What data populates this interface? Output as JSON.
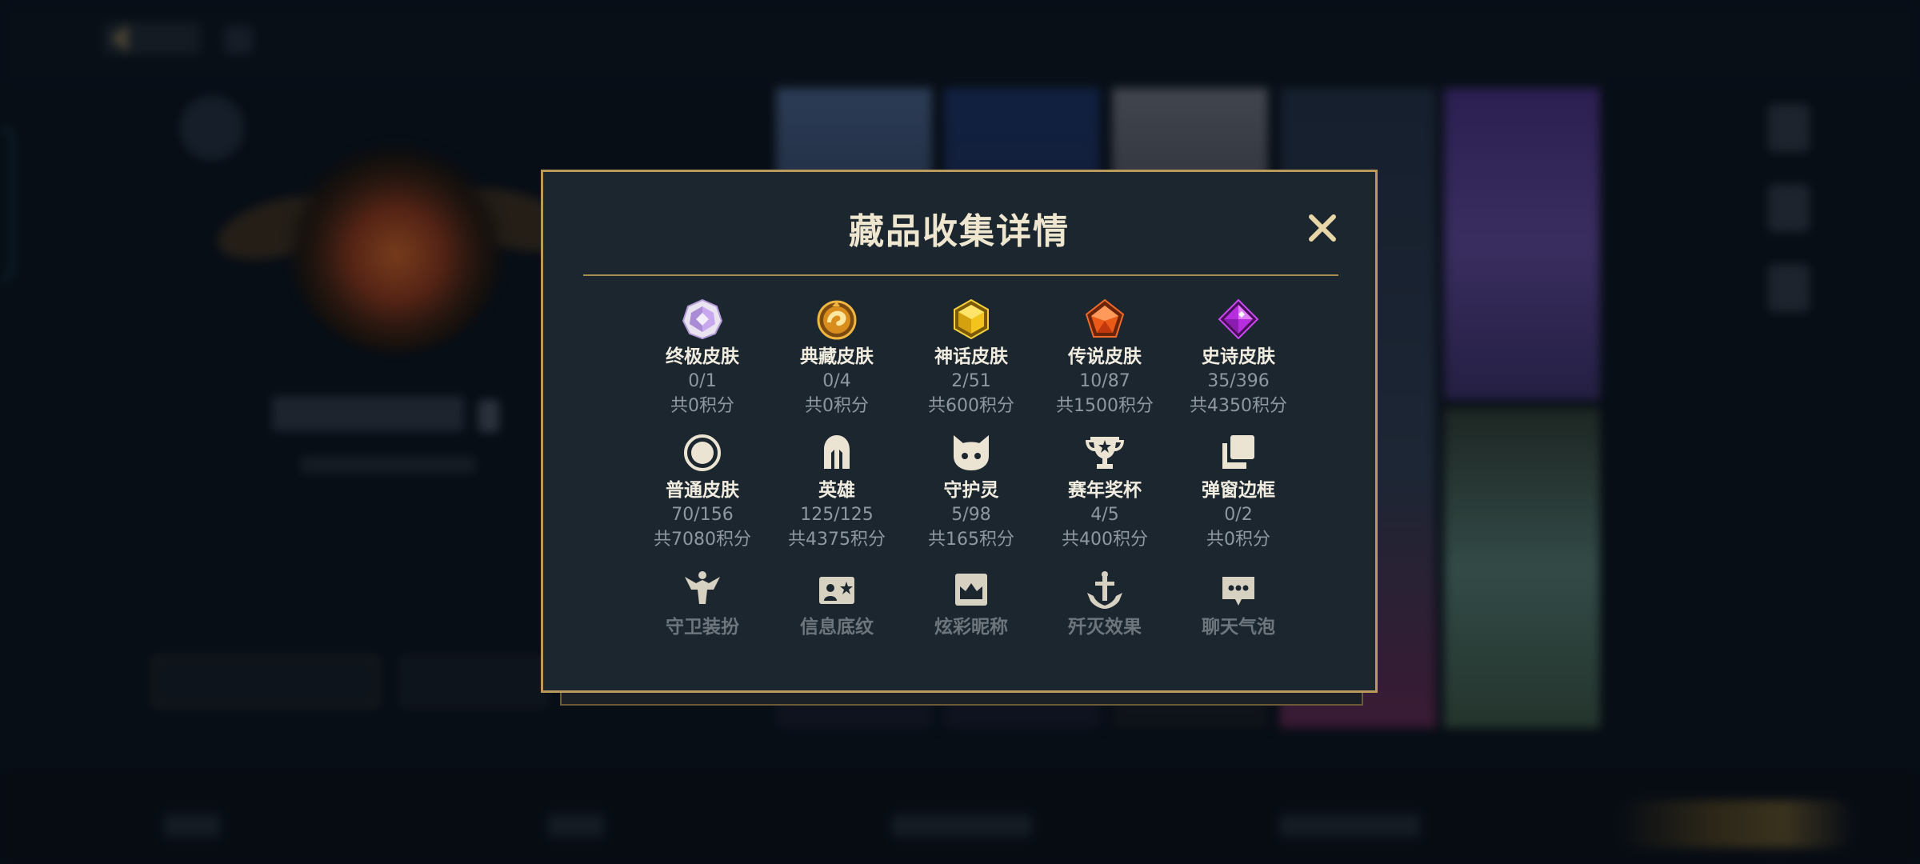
{
  "dialog": {
    "title": "藏品收集详情",
    "close_icon": "close-icon"
  },
  "colors": {
    "gold_border": "#b99a5a",
    "dialog_bg": "#1c262f",
    "title_text": "#efe6d0",
    "muted_text": "#8f989f"
  },
  "items": [
    {
      "label": "终极皮肤",
      "count": "0/1",
      "points": "共0积分",
      "icon": "ultimate-skin-gem-icon"
    },
    {
      "label": "典藏皮肤",
      "count": "0/4",
      "points": "共0积分",
      "icon": "collection-skin-dragon-icon"
    },
    {
      "label": "神话皮肤",
      "count": "2/51",
      "points": "共600积分",
      "icon": "mythic-skin-gem-icon"
    },
    {
      "label": "传说皮肤",
      "count": "10/87",
      "points": "共1500积分",
      "icon": "legend-skin-gem-icon"
    },
    {
      "label": "史诗皮肤",
      "count": "35/396",
      "points": "共4350积分",
      "icon": "epic-skin-gem-icon"
    },
    {
      "label": "普通皮肤",
      "count": "70/156",
      "points": "共7080积分",
      "icon": "normal-skin-circle-icon"
    },
    {
      "label": "英雄",
      "count": "125/125",
      "points": "共4375积分",
      "icon": "hero-helmet-icon"
    },
    {
      "label": "守护灵",
      "count": "5/98",
      "points": "共165积分",
      "icon": "guardian-spirit-icon"
    },
    {
      "label": "赛年奖杯",
      "count": "4/5",
      "points": "共400积分",
      "icon": "season-trophy-icon"
    },
    {
      "label": "弹窗边框",
      "count": "0/2",
      "points": "共0积分",
      "icon": "popup-frame-icon"
    },
    {
      "label": "守卫装扮",
      "icon": "guard-outfit-icon"
    },
    {
      "label": "信息底纹",
      "icon": "info-background-icon"
    },
    {
      "label": "炫彩昵称",
      "icon": "colorful-nickname-icon"
    },
    {
      "label": "歼灭效果",
      "icon": "annihilation-effect-icon"
    },
    {
      "label": "聊天气泡",
      "icon": "chat-bubble-icon"
    }
  ]
}
